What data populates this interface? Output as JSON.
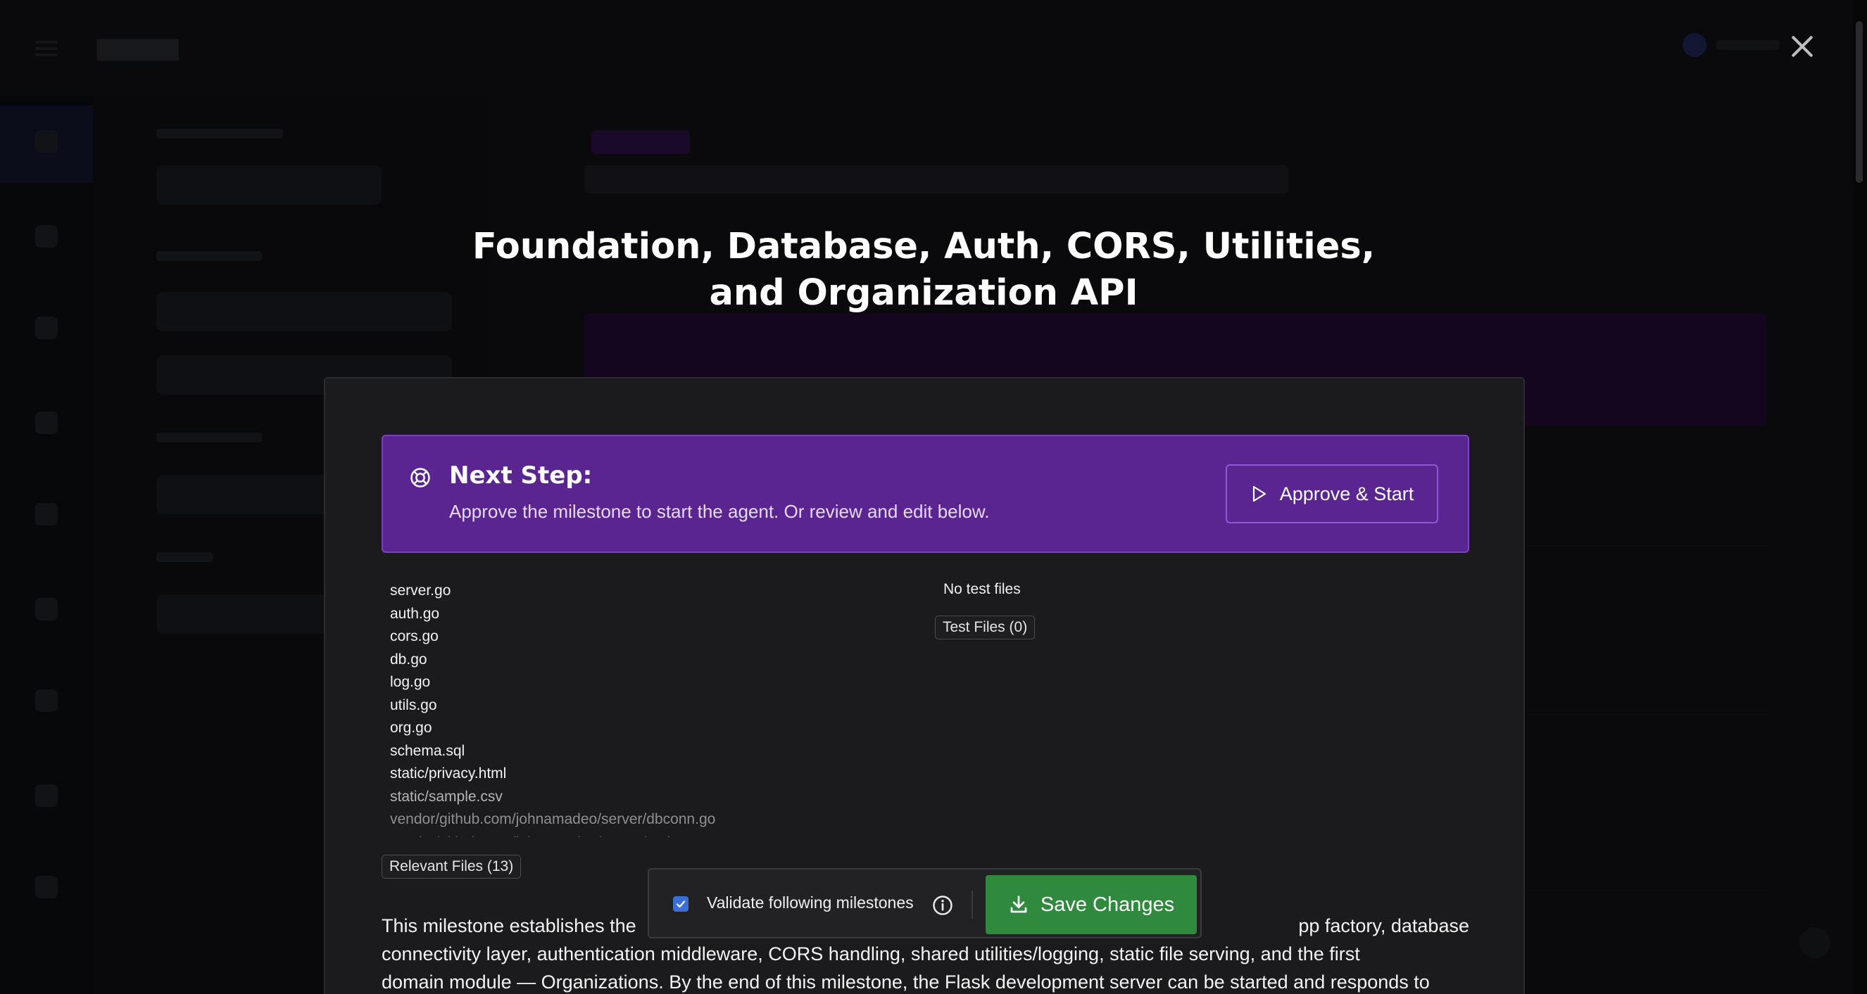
{
  "modal": {
    "title": "Foundation, Database, Auth, CORS, Utilities, and Organization API",
    "next_step": {
      "title": "Next Step:",
      "description": "Approve the milestone to start the agent. Or review and edit below.",
      "approve_label": "Approve & Start",
      "approve_icon": "play-icon",
      "step_icon": "lifebuoy-icon"
    },
    "relevant_files": [
      "server.go",
      "auth.go",
      "cors.go",
      "db.go",
      "log.go",
      "utils.go",
      "org.go",
      "schema.sql",
      "static/privacy.html",
      "static/sample.csv",
      "vendor/github.com/johnamadeo/server/dbconn.go",
      "vendor/github.com/johnamadeo/server/auth.go"
    ],
    "relevant_files_button": "Relevant Files (13)",
    "test_files_empty": "No test files",
    "test_files_button": "Test Files (0)",
    "description_visible_start": "This milestone establishes the",
    "description_visible_tail": "pp factory, database",
    "description_line2": "connectivity layer, authentication middleware, CORS handling, shared utilities/logging, static file serving, and the first",
    "description_line3": "domain module — Organizations. By the end of this milestone, the Flask development server can be started and responds to"
  },
  "save_bar": {
    "validate_label": "Validate following milestones",
    "validate_checked": true,
    "save_label": "Save Changes",
    "save_icon": "download-icon",
    "info_icon": "info-icon"
  },
  "colors": {
    "next_step_bg": "#5a2590",
    "save_button_bg": "#2f8a3d",
    "panel_bg": "#1b1b1d",
    "checkbox": "#3b6fd8"
  }
}
